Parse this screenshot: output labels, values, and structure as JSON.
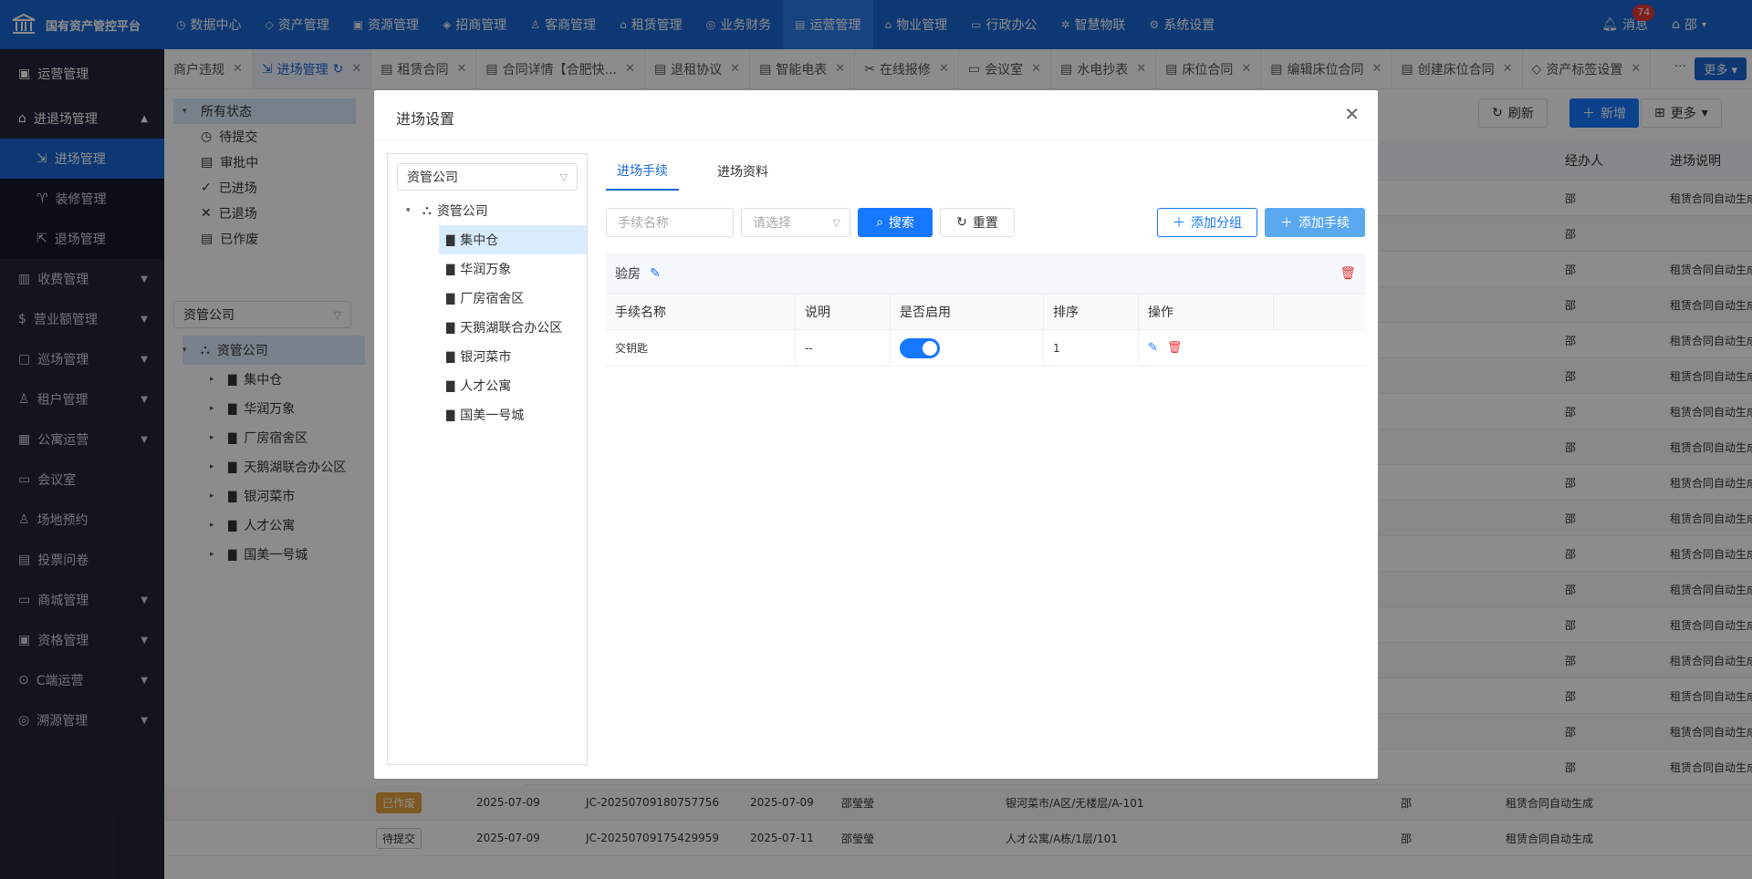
{
  "app": {
    "title": "国有资产管控平台"
  },
  "topnav": [
    {
      "icon": "◷",
      "label": "数据中心"
    },
    {
      "icon": "◇",
      "label": "资产管理"
    },
    {
      "icon": "▣",
      "label": "资源管理"
    },
    {
      "icon": "◈",
      "label": "招商管理"
    },
    {
      "icon": "♙",
      "label": "客商管理"
    },
    {
      "icon": "⌂",
      "label": "租赁管理"
    },
    {
      "icon": "◎",
      "label": "业务财务"
    },
    {
      "icon": "▤",
      "label": "运营管理"
    },
    {
      "icon": "⌂",
      "label": "物业管理"
    },
    {
      "icon": "▭",
      "label": "行政办公"
    },
    {
      "icon": "✲",
      "label": "智慧物联"
    },
    {
      "icon": "⚙",
      "label": "系统设置"
    }
  ],
  "top_right": {
    "message_label": "消息",
    "message_count": "74",
    "user": "邵"
  },
  "sidebar": {
    "header": "运营管理",
    "groups": [
      {
        "label": "进退场管理",
        "open": true,
        "subs": [
          "进场管理",
          "装修管理",
          "退场管理"
        ]
      },
      {
        "label": "收费管理"
      },
      {
        "label": "营业额管理"
      },
      {
        "label": "巡场管理"
      },
      {
        "label": "租户管理"
      },
      {
        "label": "公寓运营"
      },
      {
        "label": "会议室"
      },
      {
        "label": "场地预约"
      },
      {
        "label": "投票问卷"
      },
      {
        "label": "商城管理"
      },
      {
        "label": "资格管理"
      },
      {
        "label": "C端运营"
      },
      {
        "label": "溯源管理"
      }
    ]
  },
  "tabs": [
    "商户违规",
    "进场管理",
    "租赁合同",
    "合同详情【合肥快...",
    "退租协议",
    "智能电表",
    "在线报修",
    "会议室",
    "水电抄表",
    "床位合同",
    "编辑床位合同",
    "创建床位合同",
    "资产标签设置"
  ],
  "tabs_more": "更多",
  "status_tree": {
    "all": "所有状态",
    "items": [
      "待提交",
      "审批中",
      "已进场",
      "已退场",
      "已作废"
    ]
  },
  "bg_company_select": "资管公司",
  "bg_tree": {
    "root": "资管公司",
    "children": [
      "集中仓",
      "华润万象",
      "厂房宿舍区",
      "天鹅湖联合办公区",
      "银河菜市",
      "人才公寓",
      "国美一号城"
    ]
  },
  "list_header": {
    "refresh": "刷新",
    "add": "新增",
    "more": "更多",
    "col_handler": "经办人",
    "col_note": "进场说明"
  },
  "bg_rows": [
    {
      "handler": "邵",
      "note": "租赁合同自动生成"
    },
    {
      "handler": "邵",
      "note": ""
    },
    {
      "handler": "邵",
      "note": "租赁合同自动生成"
    },
    {
      "handler": "邵",
      "note": "租赁合同自动生成"
    },
    {
      "handler": "邵",
      "note": "租赁合同自动生成"
    },
    {
      "handler": "邵",
      "note": "租赁合同自动生成"
    },
    {
      "handler": "邵",
      "note": "租赁合同自动生成"
    },
    {
      "handler": "邵",
      "note": "租赁合同自动生成"
    },
    {
      "handler": "邵",
      "note": "租赁合同自动生成"
    },
    {
      "handler": "邵",
      "note": "租赁合同自动生成"
    },
    {
      "handler": "邵",
      "note": "租赁合同自动生成"
    },
    {
      "handler": "邵",
      "note": "租赁合同自动生成"
    },
    {
      "handler": "邵",
      "note": "租赁合同自动生成"
    },
    {
      "handler": "邵",
      "note": "租赁合同自动生成"
    },
    {
      "handler": "邵",
      "note": "租赁合同自动生成"
    },
    {
      "handler": "邵",
      "note": "租赁合同自动生成"
    },
    {
      "handler": "邵",
      "note": "租赁合同自动生成"
    }
  ],
  "bottom_rows": [
    {
      "status": "已作废",
      "date1": "2025-07-09",
      "code": "JC-20250709180757756",
      "date2": "2025-07-09",
      "person": "邵瑩瑩",
      "location": "银河菜市/A区/无楼层/A-101",
      "handler": "邵",
      "note": "租赁合同自动生成"
    },
    {
      "status": "待提交",
      "date1": "2025-07-09",
      "code": "JC-20250709175429959",
      "date2": "2025-07-11",
      "person": "邵瑩瑩",
      "location": "人才公寓/A栋/1层/101",
      "handler": "邵",
      "note": "租赁合同自动生成"
    }
  ],
  "modal": {
    "title": "进场设置",
    "company_select": "资管公司",
    "tree_root": "资管公司",
    "tree_children": [
      "集中仓",
      "华润万象",
      "厂房宿舍区",
      "天鹅湖联合办公区",
      "银河菜市",
      "人才公寓",
      "国美一号城"
    ],
    "tabs": [
      "进场手续",
      "进场资料"
    ],
    "search_placeholder": "手续名称",
    "select_placeholder": "请选择",
    "btn_search": "搜索",
    "btn_reset": "重置",
    "btn_add_group": "添加分组",
    "btn_add_proc": "添加手续",
    "group_name": "验房",
    "columns": [
      "手续名称",
      "说明",
      "是否启用",
      "排序",
      "操作"
    ],
    "rows": [
      {
        "name": "交钥匙",
        "desc": "--",
        "enabled": true,
        "order": "1"
      }
    ]
  }
}
